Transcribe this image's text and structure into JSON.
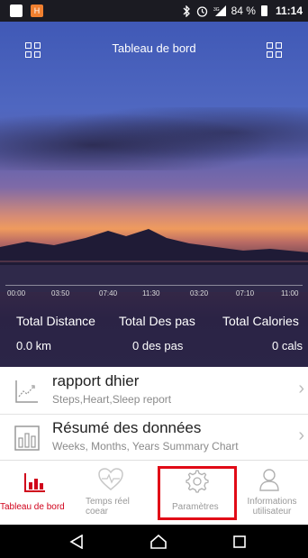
{
  "status_bar": {
    "notif_icon_1": "app-icon",
    "notif_icon_2": "H",
    "icons": [
      "bluetooth-icon",
      "alarm-icon",
      "signal-3g-icon"
    ],
    "battery": "84 %",
    "time": "11:14"
  },
  "header": {
    "title": "Tableau de bord",
    "left_icon": "grid-icon",
    "right_icon": "grid-icon"
  },
  "timeline": {
    "labels": [
      "00:00",
      "03:50",
      "07:40",
      "11:30",
      "03:20",
      "07:10",
      "11:00"
    ]
  },
  "stats": {
    "distance_label": "Total Distance",
    "distance_value": "0.0 km",
    "steps_label": "Total Des pas",
    "steps_value": "0 des pas",
    "calories_label": "Total Calories",
    "calories_value": "0 cals"
  },
  "list": [
    {
      "title": "rapport dhier",
      "subtitle": "Steps,Heart,Sleep report",
      "icon": "trend-chart-icon"
    },
    {
      "title": "Résumé des données",
      "subtitle": "Weeks, Months, Years Summary Chart",
      "icon": "bar-chart-icon"
    }
  ],
  "nav": {
    "dashboard": "Tableau de bord",
    "realtime": "Temps réel coear",
    "settings": "Paramètres",
    "user": "Informations utilisateur",
    "colors": {
      "active": "#d0021b",
      "inactive": "#999999",
      "highlight": "#e10b17"
    }
  },
  "system_nav": [
    "back-icon",
    "home-icon",
    "recents-icon"
  ]
}
